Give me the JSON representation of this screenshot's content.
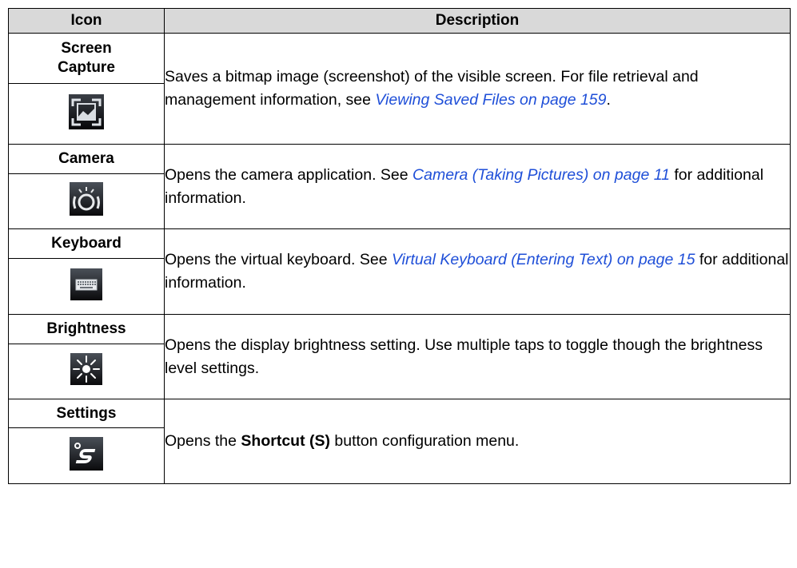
{
  "table": {
    "headers": {
      "icon": "Icon",
      "description": "Description"
    },
    "rows": [
      {
        "name_line1": "Screen",
        "name_line2": "Capture",
        "icon": "screen-capture-icon",
        "desc_pre": "Saves a bitmap image (screenshot) of the visible screen. For file retrieval and management information, see ",
        "link": "Viewing Saved Files",
        "ref": " on page 159",
        "desc_post": "."
      },
      {
        "name": "Camera",
        "icon": "camera-icon",
        "desc_pre": "Opens the camera application. See ",
        "link": "Camera (Taking Pictures)",
        "ref": " on page 11",
        "desc_post": " for additional information."
      },
      {
        "name": "Keyboard",
        "icon": "keyboard-icon",
        "desc_pre": "Opens the virtual keyboard. See ",
        "link": "Virtual Keyboard (Entering Text)",
        "ref": " on page 15",
        "desc_post": " for additional information."
      },
      {
        "name": "Brightness",
        "icon": "brightness-icon",
        "desc": "Opens the display brightness setting. Use multiple taps to toggle though the brightness level settings."
      },
      {
        "name": "Settings",
        "icon": "settings-icon",
        "desc_pre": "Opens the ",
        "desc_bold": "Shortcut (S)",
        "desc_post": " button configuration menu."
      }
    ]
  }
}
